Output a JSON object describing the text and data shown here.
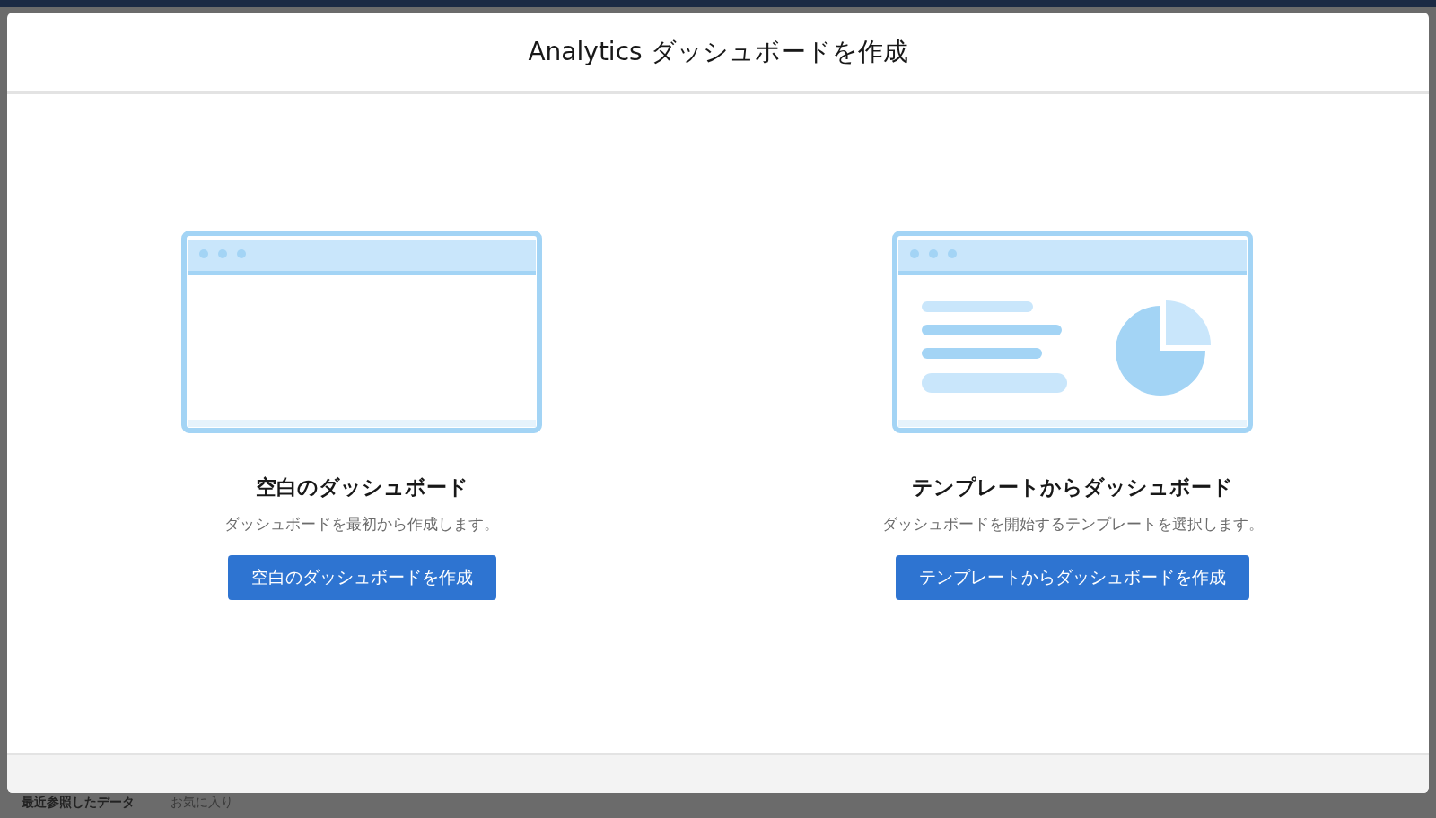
{
  "modal": {
    "title": "Analytics ダッシュボードを作成"
  },
  "options": [
    {
      "kind": "blank",
      "title": "空白のダッシュボード",
      "description": "ダッシュボードを最初から作成します。",
      "button": "空白のダッシュボードを作成"
    },
    {
      "kind": "template",
      "title": "テンプレートからダッシュボード",
      "description": "ダッシュボードを開始するテンプレートを選択します。",
      "button": "テンプレートからダッシュボードを作成"
    }
  ],
  "background_tabs": [
    "最近参照したデータ",
    "お気に入り"
  ]
}
